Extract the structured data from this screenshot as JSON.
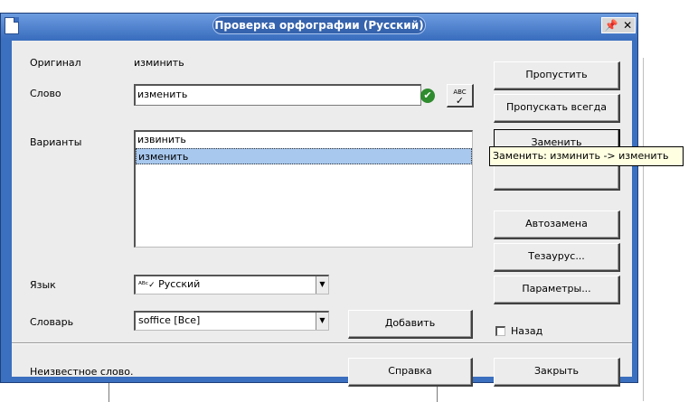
{
  "dialog": {
    "title": "Проверка орфографии (Русский)",
    "title_buttons": [
      "📌",
      "✕"
    ]
  },
  "original": {
    "label": "Оригинал",
    "value": "изминить"
  },
  "word": {
    "label": "Слово",
    "value": "изменить"
  },
  "suggestions": {
    "label": "Варианты",
    "items": [
      "извинить",
      "изменить"
    ],
    "selected_index": 1
  },
  "language": {
    "label": "Язык",
    "value": "Русский"
  },
  "dictionary": {
    "label": "Словарь",
    "value": "soffice [Все]"
  },
  "buttons": {
    "ignore": "Пропустить",
    "ignore_all": "Пропускать всегда",
    "change": "Заменить",
    "autocorrect": "Автозамена",
    "thesaurus": "Тезаурус...",
    "options": "Параметры...",
    "add": "Добавить",
    "help": "Справка",
    "close": "Закрыть"
  },
  "back": {
    "label": "Назад"
  },
  "status": "Неизвестное слово.",
  "tooltip": "Заменить: изминить -> изменить",
  "colors": {
    "titlebar": "#3b6fbf",
    "selection": "#a8c8ee",
    "check": "#2e8b2e",
    "tooltip_bg": "#ffffe1"
  },
  "icons": [
    "app-icon",
    "pin-icon",
    "close-icon",
    "check-icon",
    "spellcheck-icon",
    "language-icon"
  ]
}
